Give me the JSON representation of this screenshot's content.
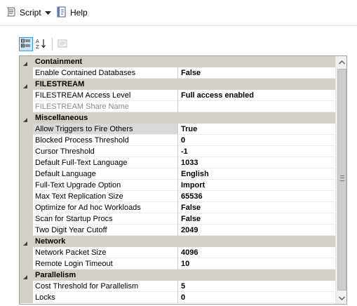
{
  "toolbar": {
    "script_label": "Script",
    "help_label": "Help",
    "script_icon": "script-icon",
    "dropdown_icon": "chevron-down-icon",
    "help_icon": "help-icon"
  },
  "grid_toolbar": {
    "categorized_icon": "categorized-icon",
    "alphabetical_icon": "alphabetical-sort-icon",
    "property_pages_icon": "property-pages-icon"
  },
  "categories": [
    {
      "name": "Containment",
      "properties": [
        {
          "name": "Enable Contained Databases",
          "value": "False"
        }
      ]
    },
    {
      "name": "FILESTREAM",
      "properties": [
        {
          "name": "FILESTREAM Access Level",
          "value": "Full access enabled"
        },
        {
          "name": "FILESTREAM Share Name",
          "value": ""
        }
      ]
    },
    {
      "name": "Miscellaneous",
      "properties": [
        {
          "name": "Allow Triggers to Fire Others",
          "value": "True"
        },
        {
          "name": "Blocked Process Threshold",
          "value": "0"
        },
        {
          "name": "Cursor Threshold",
          "value": "-1"
        },
        {
          "name": "Default Full-Text Language",
          "value": "1033"
        },
        {
          "name": "Default Language",
          "value": "English"
        },
        {
          "name": "Full-Text Upgrade Option",
          "value": "Import"
        },
        {
          "name": "Max Text Replication Size",
          "value": "65536"
        },
        {
          "name": "Optimize for Ad hoc Workloads",
          "value": "False"
        },
        {
          "name": "Scan for Startup Procs",
          "value": "False"
        },
        {
          "name": "Two Digit Year Cutoff",
          "value": "2049"
        }
      ]
    },
    {
      "name": "Network",
      "properties": [
        {
          "name": "Network Packet Size",
          "value": "4096"
        },
        {
          "name": "Remote Login Timeout",
          "value": "10"
        }
      ]
    },
    {
      "name": "Parallelism",
      "properties": [
        {
          "name": "Cost Threshold for Parallelism",
          "value": "5"
        },
        {
          "name": "Locks",
          "value": "0"
        }
      ]
    }
  ],
  "colors": {
    "category_bg": "#d4d0c8",
    "accent_selected": "#3399ff"
  }
}
